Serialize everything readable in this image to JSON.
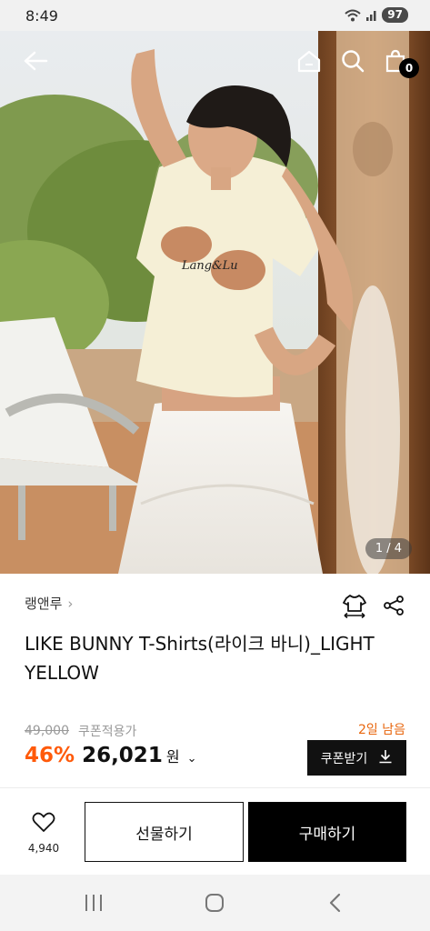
{
  "status_bar": {
    "time": "8:49",
    "battery": "97",
    "icons": [
      "wifi-icon",
      "signal-icon"
    ]
  },
  "hero": {
    "counter": "1 / 4",
    "nav_icons": [
      "back-arrow-icon",
      "home-icon",
      "search-icon",
      "cart-icon"
    ],
    "cart_count": "0",
    "shirt_print_text": "Lang&Lu"
  },
  "product": {
    "brand": "랭앤루",
    "brand_chevron": "›",
    "title": "LIKE BUNNY T-Shirts(라이크 바니)_LIGHT YELLOW",
    "original_price": "49,000",
    "coupon_note": "쿠폰적용가",
    "discount": "46%",
    "price": "26,021",
    "currency": "원",
    "currency_chevron": "⌄",
    "days_left": "2일 남음",
    "coupon_button": "쿠폰받기",
    "action_icons": [
      "size-guide-icon",
      "share-icon"
    ]
  },
  "actions": {
    "like_count": "4,940",
    "gift_label": "선물하기",
    "buy_label": "구매하기"
  },
  "system_nav": [
    "recent-apps-icon",
    "home-button-icon",
    "back-button-icon"
  ],
  "colors": {
    "discount": "#ff5a0a",
    "days_left": "#e8670f",
    "primary": "#000000"
  }
}
